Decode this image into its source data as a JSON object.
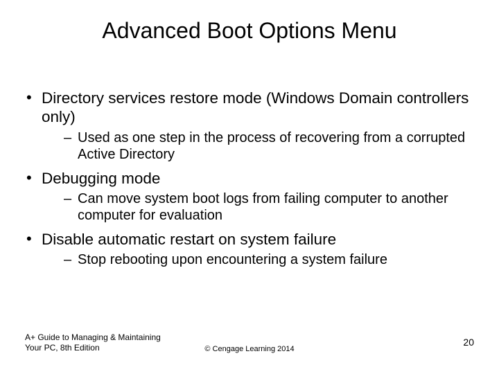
{
  "title": "Advanced Boot Options Menu",
  "bullets": [
    {
      "text": "Directory services restore mode (Windows Domain controllers only)",
      "sub": [
        "Used as one step in the process of recovering from a corrupted Active Directory"
      ]
    },
    {
      "text": "Debugging mode",
      "sub": [
        "Can move system boot logs from failing computer to another computer for evaluation"
      ]
    },
    {
      "text": "Disable automatic restart on system failure",
      "sub": [
        "Stop rebooting upon encountering a system failure"
      ]
    }
  ],
  "footer": {
    "left_line1": "A+ Guide to Managing & Maintaining",
    "left_line2": "Your PC, 8th Edition",
    "center": "© Cengage Learning  2014",
    "page_number": "20"
  }
}
